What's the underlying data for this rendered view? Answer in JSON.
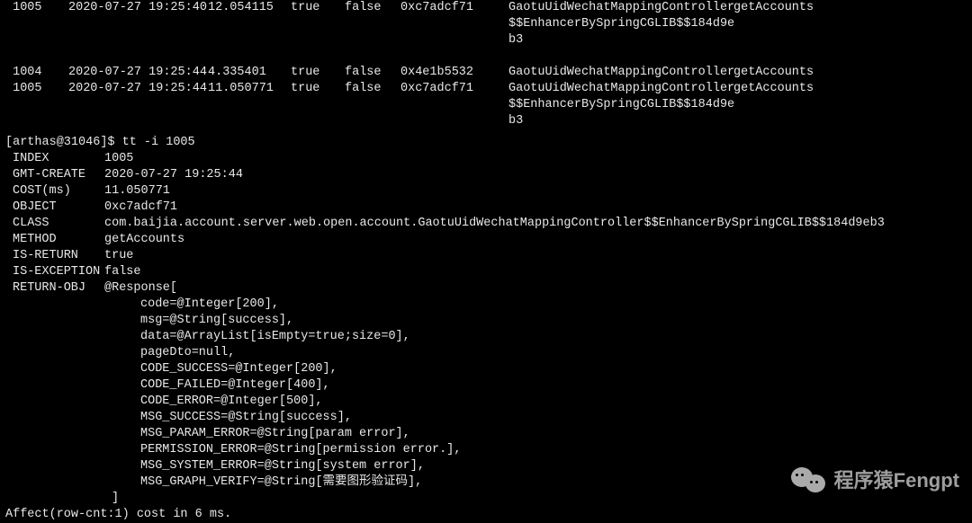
{
  "table": {
    "rows": [
      {
        "idx": "1005",
        "ts": "2020-07-27 19:25:40",
        "cost": "12.054115",
        "ret": "true",
        "exc": "false",
        "obj": "0xc7adcf71",
        "cls": "GaotuUidWechatMappingController",
        "mth": "getAccounts",
        "extra": "$$EnhancerBySpringCGLIB$$184d9e",
        "extra2": "b3"
      },
      {
        "idx": "1004",
        "ts": "2020-07-27 19:25:44",
        "cost": "4.335401",
        "ret": "true",
        "exc": "false",
        "obj": "0x4e1b5532",
        "cls": "GaotuUidWechatMappingController",
        "mth": "getAccounts",
        "extra": "",
        "extra2": ""
      },
      {
        "idx": "1005",
        "ts": "2020-07-27 19:25:44",
        "cost": "11.050771",
        "ret": "true",
        "exc": "false",
        "obj": "0xc7adcf71",
        "cls": "GaotuUidWechatMappingController",
        "mth": "getAccounts",
        "extra": "$$EnhancerBySpringCGLIB$$184d9e",
        "extra2": "b3"
      }
    ]
  },
  "prompt": {
    "user": "[arthas@31046]$ ",
    "cmd": "tt -i 1005"
  },
  "detail": {
    "index_k": "INDEX",
    "index_v": "1005",
    "gmt_k": "GMT-CREATE",
    "gmt_v": "2020-07-27 19:25:44",
    "cost_k": "COST(ms)",
    "cost_v": "11.050771",
    "obj_k": "OBJECT",
    "obj_v": "0xc7adcf71",
    "cls_k": "CLASS",
    "cls_v": "com.baijia.account.server.web.open.account.GaotuUidWechatMappingController$$EnhancerBySpringCGLIB$$184d9eb3",
    "mth_k": "METHOD",
    "mth_v": "getAccounts",
    "isret_k": "IS-RETURN",
    "isret_v": "true",
    "isexc_k": "IS-EXCEPTION",
    "isexc_v": "false",
    "retobj_k": "RETURN-OBJ",
    "retobj_head": "@Response[",
    "body": [
      "code=@Integer[200],",
      "msg=@String[success],",
      "data=@ArrayList[isEmpty=true;size=0],",
      "pageDto=null,",
      "CODE_SUCCESS=@Integer[200],",
      "CODE_FAILED=@Integer[400],",
      "CODE_ERROR=@Integer[500],",
      "MSG_SUCCESS=@String[success],",
      "MSG_PARAM_ERROR=@String[param error],",
      "PERMISSION_ERROR=@String[permission error.],",
      "MSG_SYSTEM_ERROR=@String[system error],",
      "MSG_GRAPH_VERIFY=@String[需要图形验证码],"
    ],
    "close": "]"
  },
  "footer": "Affect(row-cnt:1) cost in 6 ms.",
  "watermark": "程序猿Fengpt"
}
